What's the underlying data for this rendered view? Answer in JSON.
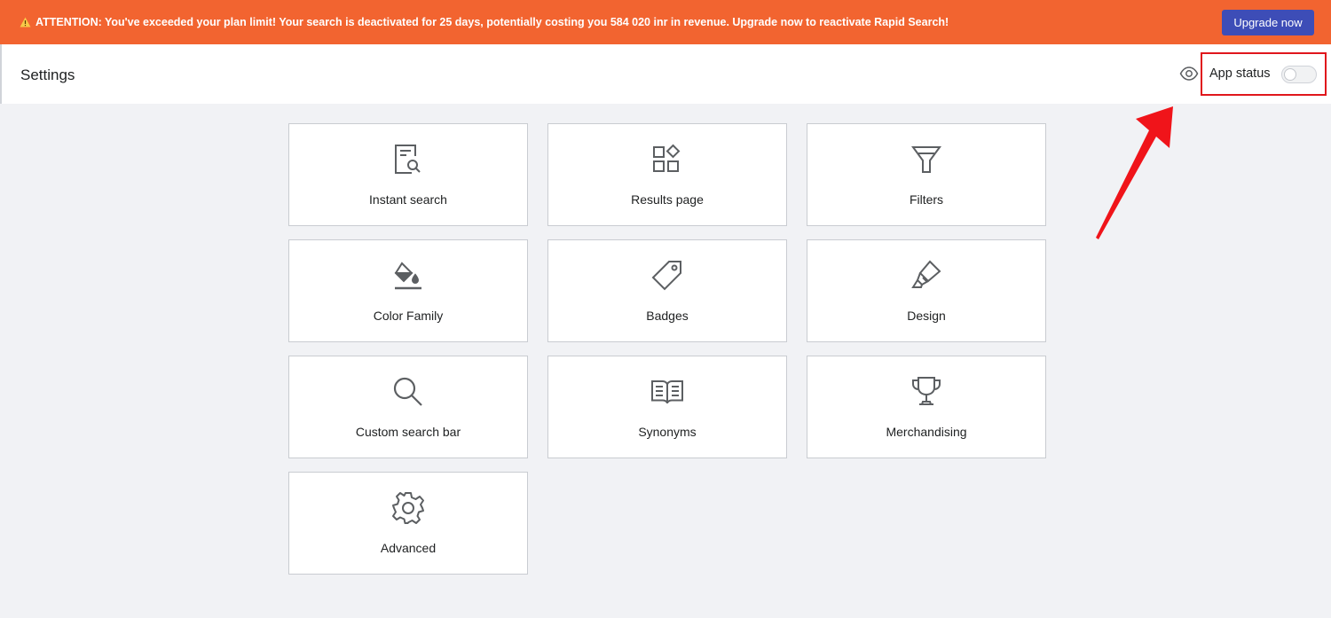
{
  "banner": {
    "message": "ATTENTION: You've exceeded your plan limit! Your search is deactivated for 25 days, potentially costing you 584 020 inr in revenue. Upgrade now to reactivate Rapid Search!",
    "upgrade_label": "Upgrade now",
    "icon": "warning-icon"
  },
  "header": {
    "title": "Settings",
    "preview_icon": "eye-icon",
    "app_status_label": "App status",
    "app_status_on": false
  },
  "cards": [
    {
      "label": "Instant search",
      "icon": "instant-search-icon"
    },
    {
      "label": "Results page",
      "icon": "results-page-icon"
    },
    {
      "label": "Filters",
      "icon": "filter-icon"
    },
    {
      "label": "Color Family",
      "icon": "paint-bucket-icon"
    },
    {
      "label": "Badges",
      "icon": "tag-icon"
    },
    {
      "label": "Design",
      "icon": "highlighter-icon"
    },
    {
      "label": "Custom search bar",
      "icon": "search-icon"
    },
    {
      "label": "Synonyms",
      "icon": "book-icon"
    },
    {
      "label": "Merchandising",
      "icon": "trophy-icon"
    },
    {
      "label": "Advanced",
      "icon": "gear-icon"
    }
  ],
  "colors": {
    "banner": "#f26430",
    "upgrade_button": "#3d4db7",
    "annotation": "#e0161c"
  }
}
